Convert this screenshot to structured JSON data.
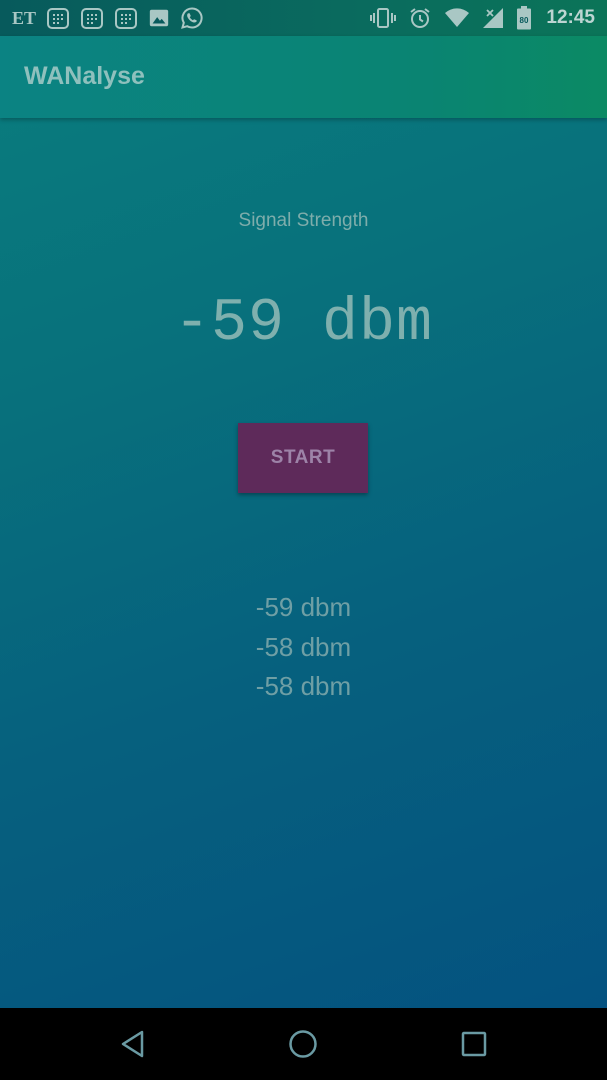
{
  "status_bar": {
    "left_icons": [
      "et-news-icon",
      "calendar-icon",
      "calendar-icon",
      "calendar-icon",
      "image-icon",
      "whatsapp-icon"
    ],
    "et_label": "ET",
    "right_icons": [
      "vibrate-icon",
      "alarm-icon",
      "wifi-icon",
      "signal-icon",
      "battery-icon"
    ],
    "battery_level": "80",
    "time": "12:45"
  },
  "app_bar": {
    "title": "WANalyse"
  },
  "main": {
    "signal_label": "Signal Strength",
    "current_value": "-59 dbm",
    "start_button": "START",
    "history": [
      "-59 dbm",
      "-58 dbm",
      "-58 dbm"
    ]
  },
  "nav_bar": {
    "buttons": [
      "back-icon",
      "home-icon",
      "recents-icon"
    ]
  }
}
